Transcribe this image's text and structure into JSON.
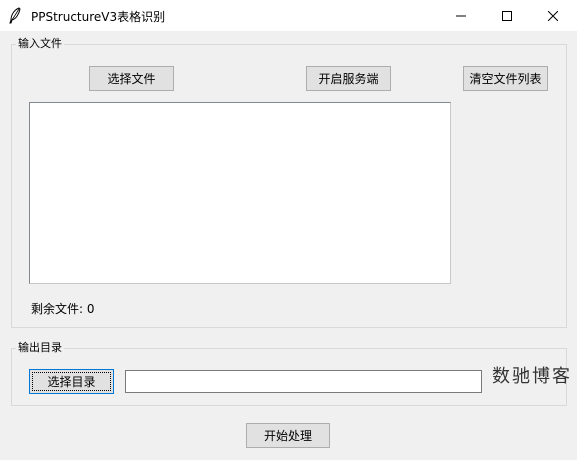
{
  "window": {
    "title": "PPStructureV3表格识别"
  },
  "input_group": {
    "label": "输入文件",
    "select_file_button": "选择文件",
    "start_service_button": "开启服务端",
    "clear_list_button": "清空文件列表",
    "file_list": [],
    "remaining_label": "剩余文件: 0"
  },
  "output_group": {
    "label": "输出目录",
    "select_dir_button": "选择目录",
    "dir_path_value": ""
  },
  "start_button": "开始处理",
  "watermark": "数驰博客"
}
